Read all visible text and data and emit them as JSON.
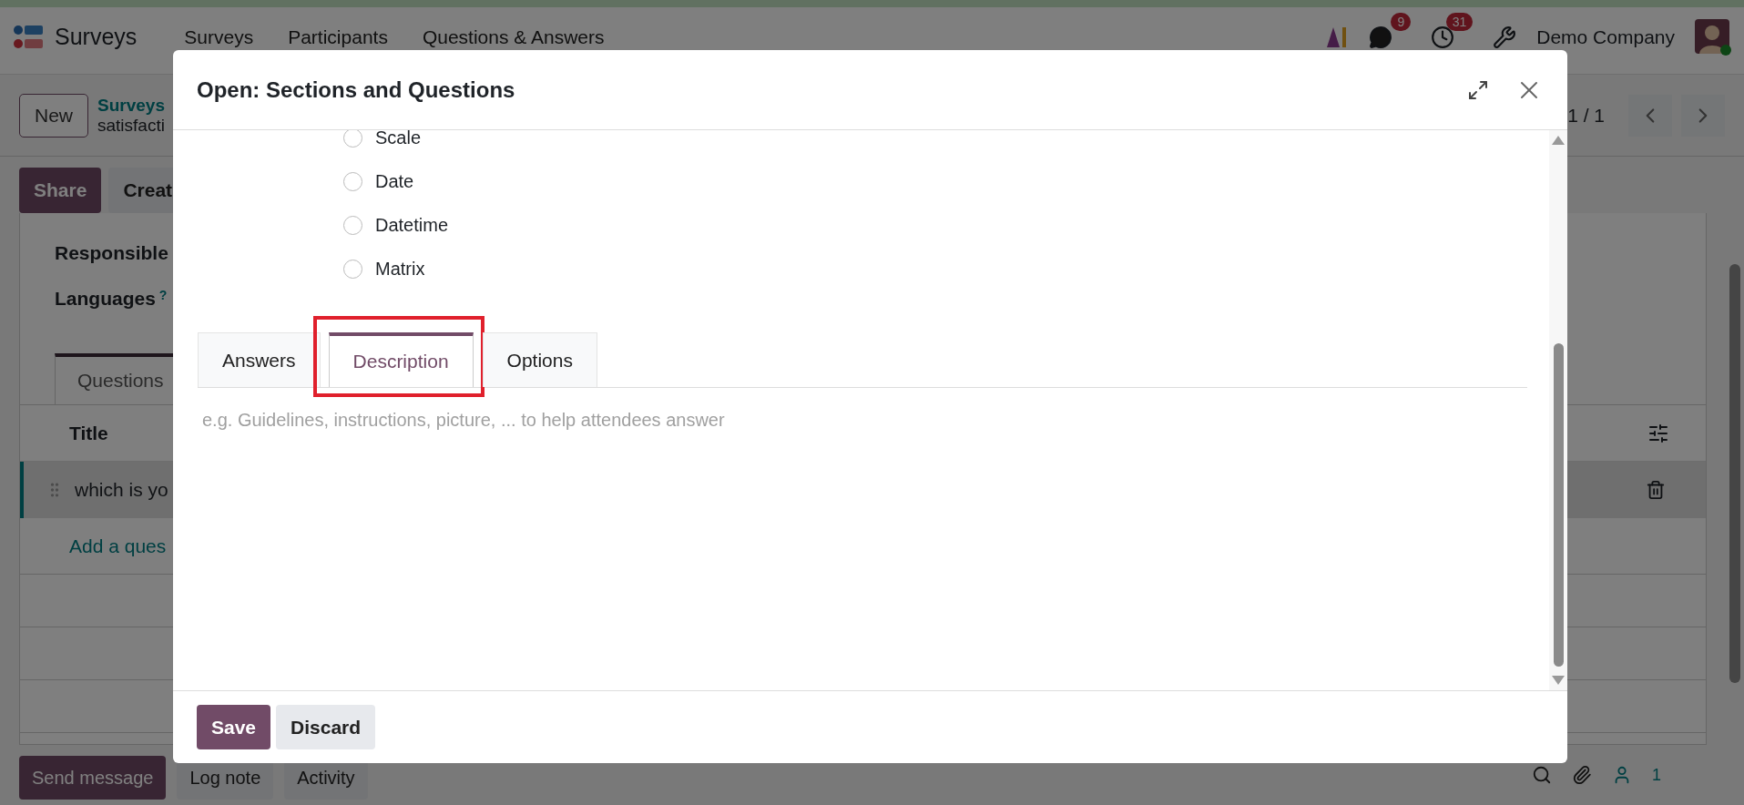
{
  "navbar": {
    "app_name": "Surveys",
    "menu": [
      "Surveys",
      "Participants",
      "Questions & Answers"
    ],
    "messages_count": "9",
    "activities_count": "31",
    "company": "Demo Company"
  },
  "control_panel": {
    "new_button": "New",
    "breadcrumb": "Surveys",
    "record": "satisfacti",
    "pager": "1 / 1"
  },
  "actions": [
    {
      "label": "Share",
      "kind": "primary"
    },
    {
      "label": "Creat",
      "kind": "secondary"
    }
  ],
  "form": {
    "fields": [
      {
        "label": "Responsible"
      },
      {
        "label": "Languages",
        "help": "?"
      }
    ],
    "tabs": [
      {
        "label": "Questions",
        "selected": true
      }
    ],
    "list": {
      "columns": [
        "Title"
      ],
      "rows": [
        {
          "title": "which is yo",
          "selected": true
        }
      ],
      "add_line": "Add a ques"
    }
  },
  "chatter": {
    "buttons": [
      {
        "label": "Send message",
        "kind": "primary"
      },
      {
        "label": "Log note",
        "kind": "secondary"
      },
      {
        "label": "Activity",
        "kind": "secondary"
      }
    ],
    "followers": "1"
  },
  "dialog": {
    "title": "Open: Sections and Questions",
    "question_types": [
      {
        "label": "Scale",
        "selected": false
      },
      {
        "label": "Date",
        "selected": false
      },
      {
        "label": "Datetime",
        "selected": false
      },
      {
        "label": "Matrix",
        "selected": false
      }
    ],
    "tabs": [
      {
        "label": "Answers",
        "selected": false,
        "highlighted": false
      },
      {
        "label": "Description",
        "selected": true,
        "highlighted": true
      },
      {
        "label": "Options",
        "selected": false,
        "highlighted": false
      }
    ],
    "description": {
      "placeholder": "e.g. Guidelines, instructions, picture, ... to help attendees answer"
    },
    "buttons": [
      {
        "label": "Save",
        "kind": "primary"
      },
      {
        "label": "Discard",
        "kind": "secondary"
      }
    ]
  }
}
